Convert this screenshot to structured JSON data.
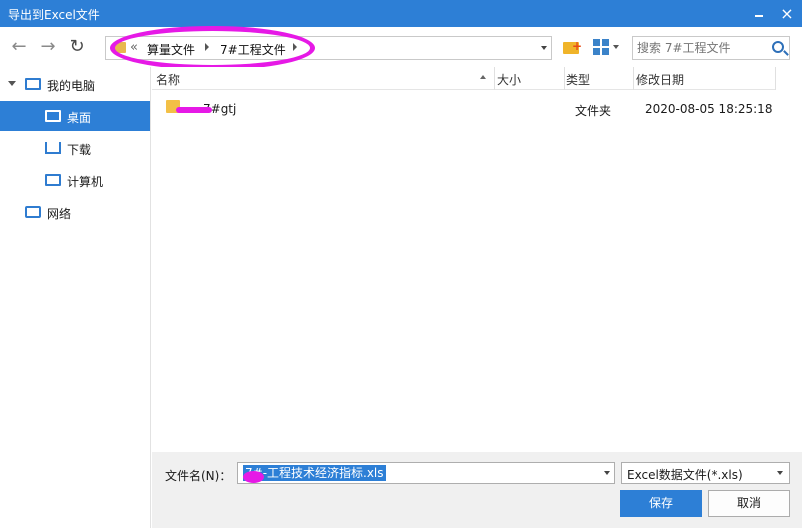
{
  "window": {
    "title": "导出到Excel文件",
    "minimize": "▫",
    "close": "×"
  },
  "toolbar": {
    "back": "←",
    "forward": "→",
    "refresh": "↻",
    "breadcrumb": [
      "算量文件",
      "7#工程文件"
    ],
    "overflow": "«",
    "search_placeholder": "搜索 7#工程文件"
  },
  "sidebar": {
    "items": [
      {
        "label": "我的电脑",
        "icon": "computer-icon"
      },
      {
        "label": "桌面",
        "icon": "desktop-icon",
        "selected": true
      },
      {
        "label": "下载",
        "icon": "download-icon"
      },
      {
        "label": "计算机",
        "icon": "computer-icon"
      },
      {
        "label": "网络",
        "icon": "network-icon"
      }
    ]
  },
  "list": {
    "columns": [
      "名称",
      "大小",
      "类型",
      "修改日期"
    ],
    "rows": [
      {
        "name": "7#gtj",
        "size": "",
        "type": "文件夹",
        "modified": "2020-08-05 18:25:18"
      }
    ]
  },
  "bottom": {
    "filename_label": "文件名(N)：",
    "filename_value": "7#-工程技术经济指标.xls",
    "filetype_value": "Excel数据文件(*.xls)",
    "save_label": "保存",
    "cancel_label": "取消"
  },
  "colors": {
    "accent": "#2d7fd6",
    "highlight": "#e619e6",
    "folder": "#f3c046"
  }
}
